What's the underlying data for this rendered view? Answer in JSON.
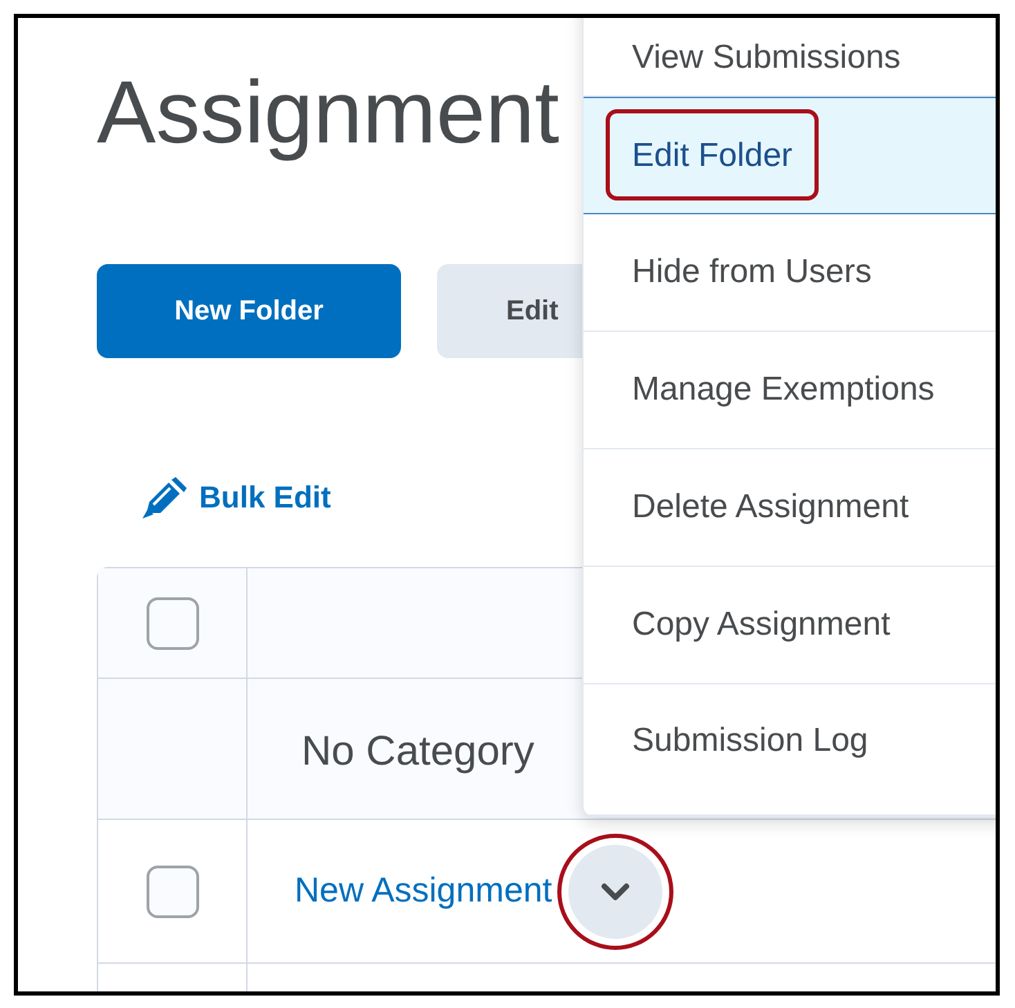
{
  "page": {
    "title": "Assignment"
  },
  "buttons": [
    {
      "label": "New Folder",
      "kind": "primary"
    },
    {
      "label": "Edit",
      "kind": "secondary"
    }
  ],
  "bulk_edit": {
    "label": "Bulk Edit"
  },
  "table": {
    "header_checked": false,
    "category": "No Category",
    "rows": [
      {
        "name": "New Assignment",
        "checked": false
      }
    ]
  },
  "context_menu": {
    "items": [
      {
        "label": "View Submissions",
        "selected": false
      },
      {
        "label": "Edit Folder",
        "selected": true
      },
      {
        "label": "Hide from Users",
        "selected": false
      },
      {
        "label": "Manage Exemptions",
        "selected": false
      },
      {
        "label": "Delete Assignment",
        "selected": false
      },
      {
        "label": "Copy Assignment",
        "selected": false
      },
      {
        "label": "Submission Log",
        "selected": false
      }
    ]
  }
}
